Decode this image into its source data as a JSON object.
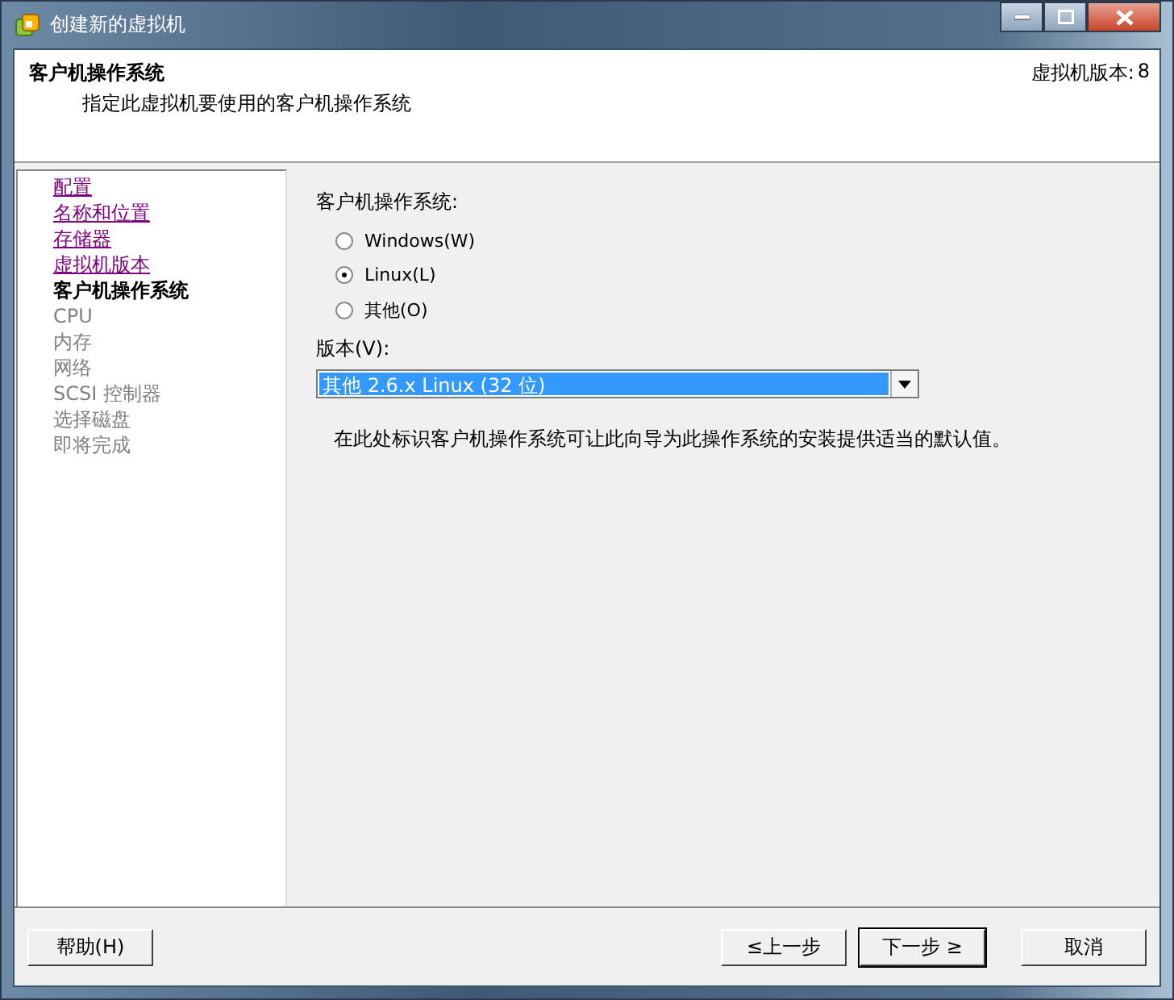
{
  "window": {
    "title": "创建新的虚拟机"
  },
  "header": {
    "title": "客户机操作系统",
    "subtitle": "指定此虚拟机要使用的客户机操作系统",
    "version_label": "虚拟机版本:",
    "version_value": "8"
  },
  "steps": [
    {
      "label": "配置",
      "kind": "visited"
    },
    {
      "label": "名称和位置",
      "kind": "visited"
    },
    {
      "label": "存储器",
      "kind": "visited"
    },
    {
      "label": "虚拟机版本",
      "kind": "visited"
    },
    {
      "label": "客户机操作系统",
      "kind": "current"
    },
    {
      "label": "CPU",
      "kind": "pending"
    },
    {
      "label": "内存",
      "kind": "pending"
    },
    {
      "label": "网络",
      "kind": "pending"
    },
    {
      "label": "SCSI 控制器",
      "kind": "pending"
    },
    {
      "label": "选择磁盘",
      "kind": "pending"
    },
    {
      "label": "即将完成",
      "kind": "pending"
    }
  ],
  "os_group": {
    "label": "客户机操作系统:",
    "options": [
      {
        "label": "Windows(W)",
        "selected": false
      },
      {
        "label": "Linux(L)",
        "selected": true
      },
      {
        "label": "其他(O)",
        "selected": false
      }
    ]
  },
  "version": {
    "label": "版本(V):",
    "value": "其他 2.6.x Linux (32 位)"
  },
  "hint": "在此处标识客户机操作系统可让此向导为此操作系统的安装提供适当的默认值。",
  "buttons": {
    "help": "帮助(H)",
    "back": "≤上一步",
    "next": "下一步 ≥",
    "cancel": "取消"
  }
}
